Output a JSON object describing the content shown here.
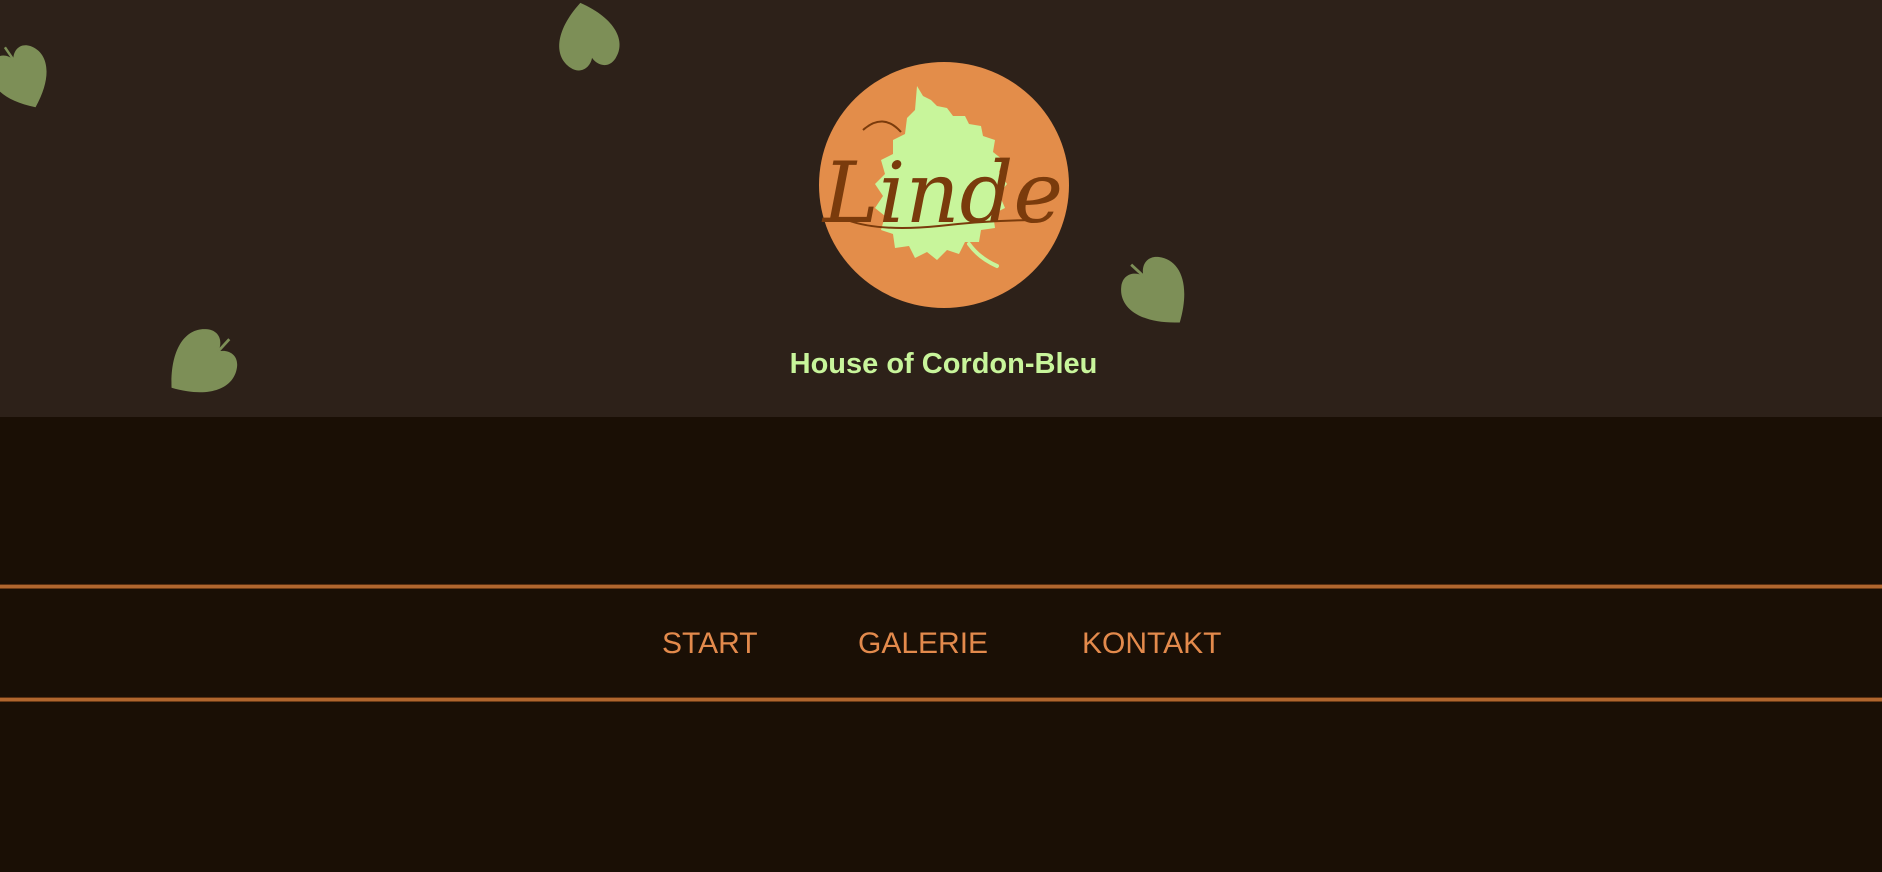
{
  "header": {
    "logo": {
      "script_text": "Linde",
      "circle_color": "#e38d4a",
      "leaf_color": "#c8f59b",
      "script_color": "#7a3b0c"
    },
    "tagline": "House of Cordon-Bleu",
    "background_color": "#2d2119",
    "decorative_leaf_color": "#7d8f57"
  },
  "nav": {
    "items": [
      {
        "label": "START"
      },
      {
        "label": "GALERIE"
      },
      {
        "label": "KONTAKT"
      }
    ],
    "text_color": "#e38a4c",
    "line_color": "#b0662e"
  },
  "page": {
    "background_color": "#1a0f05"
  }
}
